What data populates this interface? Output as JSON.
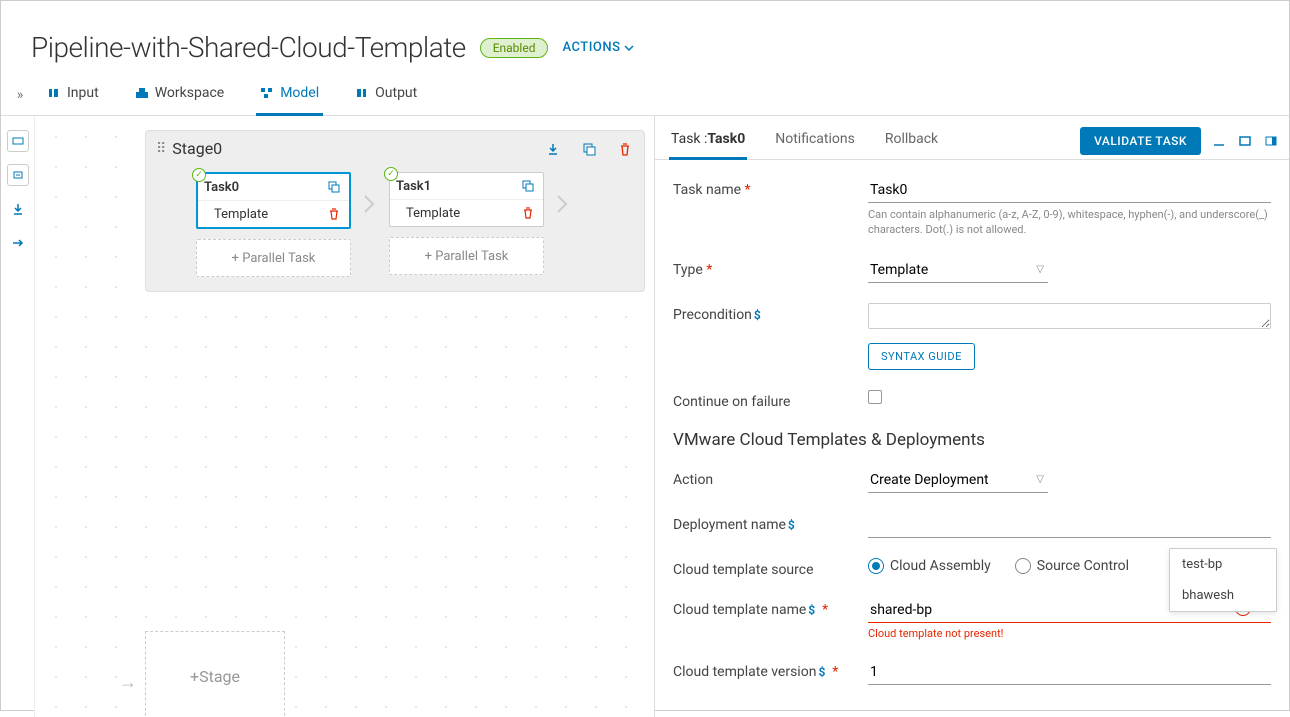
{
  "header": {
    "title": "Pipeline-with-Shared-Cloud-Template",
    "status": "Enabled",
    "actions_label": "ACTIONS"
  },
  "tabs": {
    "input": "Input",
    "workspace": "Workspace",
    "model": "Model",
    "output": "Output"
  },
  "stage": {
    "name": "Stage0",
    "task0": {
      "name": "Task0",
      "type": "Template"
    },
    "task1": {
      "name": "Task1",
      "type": "Template"
    },
    "parallel_label": "+ Parallel Task",
    "add_stage": "+Stage"
  },
  "panel": {
    "tabs": {
      "task_prefix": "Task :",
      "task_name": "Task0",
      "notifications": "Notifications",
      "rollback": "Rollback"
    },
    "validate": "VALIDATE TASK"
  },
  "form": {
    "task_name": {
      "label": "Task name",
      "value": "Task0",
      "help": "Can contain alphanumeric (a-z, A-Z, 0-9), whitespace, hyphen(-), and underscore(_) characters. Dot(.) is not allowed."
    },
    "type": {
      "label": "Type",
      "value": "Template"
    },
    "precondition": {
      "label": "Precondition",
      "value": ""
    },
    "syntax_guide": "SYNTAX GUIDE",
    "continue_on_failure": {
      "label": "Continue on failure"
    },
    "section_title": "VMware Cloud Templates & Deployments",
    "action": {
      "label": "Action",
      "value": "Create Deployment"
    },
    "deployment_name": {
      "label": "Deployment name",
      "value": ""
    },
    "template_source": {
      "label": "Cloud template source",
      "opt1": "Cloud Assembly",
      "opt2": "Source Control"
    },
    "template_name": {
      "label": "Cloud template name",
      "value": "shared-bp",
      "error": "Cloud template not present!"
    },
    "template_version": {
      "label": "Cloud template version",
      "value": "1"
    }
  },
  "dropdown": {
    "items": [
      "test-bp",
      "bhawesh"
    ]
  }
}
